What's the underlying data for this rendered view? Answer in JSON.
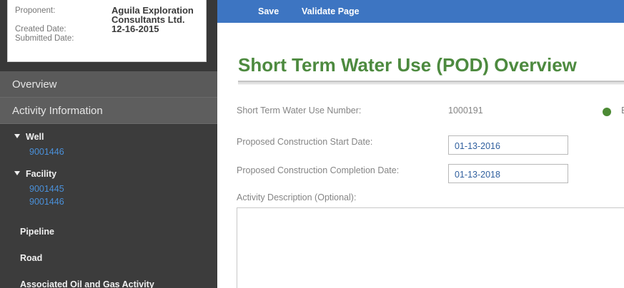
{
  "sidebar": {
    "meta": {
      "proponent_label": "Proponent:",
      "proponent_value_line1": "Aguila Exploration",
      "proponent_value_line2": "Consultants Ltd.",
      "created_label": "Created Date:",
      "created_value": "12-16-2015",
      "submitted_label": "Submitted Date:"
    },
    "overview": "Overview",
    "activity_information": "Activity Information",
    "well": {
      "label": "Well",
      "links": [
        "9001446"
      ]
    },
    "facility": {
      "label": "Facility",
      "links": [
        "9001445",
        "9001446"
      ]
    },
    "pipeline": "Pipeline",
    "road": "Road",
    "associated": "Associated Oil and Gas Activity"
  },
  "toolbar": {
    "save_label": "Save",
    "validate_label": "Validate Page"
  },
  "main": {
    "title": "Short Term Water Use (POD) Overview",
    "number_label": "Short Term Water Use Number:",
    "number_value": "1000191",
    "status_text": "E",
    "status_color": "#4c8a34",
    "start_label": "Proposed Construction Start Date:",
    "start_value": "01-13-2016",
    "completion_label": "Proposed Construction Completion Date:",
    "completion_value": "01-13-2018",
    "description_label": "Activity Description (Optional):"
  }
}
